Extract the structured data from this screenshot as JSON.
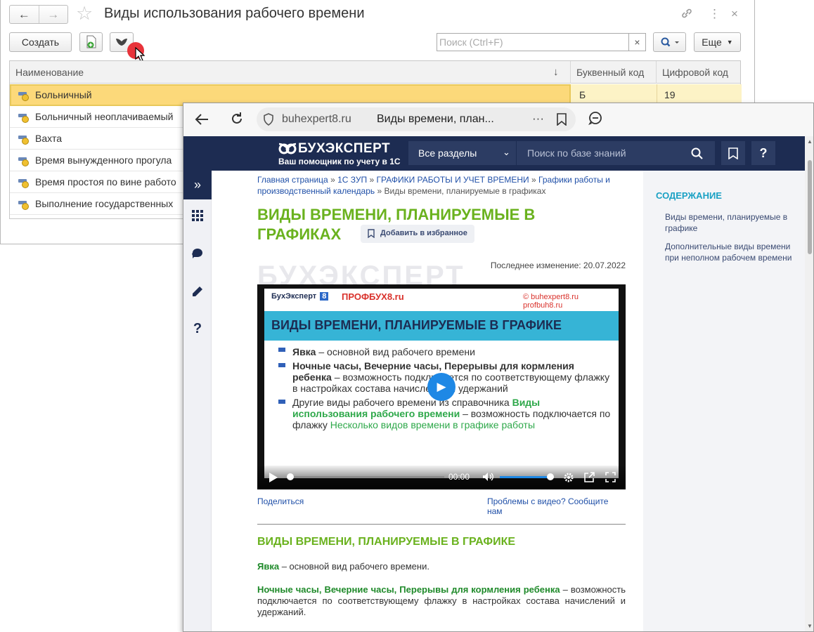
{
  "win1c": {
    "title": "Виды использования рабочего времени",
    "back_icon": "←",
    "forward_icon": "→",
    "link_icon": "🔗",
    "more_icon": "⋮",
    "close_icon": "×",
    "create_label": "Создать",
    "more_label": "Еще",
    "search_placeholder": "Поиск (Ctrl+F)",
    "search_clear": "×",
    "sort_indicator": "↓",
    "columns": [
      "Наименование",
      "Буквенный код",
      "Цифровой код"
    ],
    "rows": [
      {
        "name": "Больничный",
        "letter": "Б",
        "digit": "19"
      },
      {
        "name": "Больничный неоплачиваемый",
        "letter": "",
        "digit": ""
      },
      {
        "name": "Вахта",
        "letter": "",
        "digit": ""
      },
      {
        "name": "Время вынужденного прогула",
        "letter": "",
        "digit": ""
      },
      {
        "name": "Время простоя по вине работо",
        "letter": "",
        "digit": ""
      },
      {
        "name": "Выполнение государственных",
        "letter": "",
        "digit": ""
      }
    ]
  },
  "browser": {
    "url": "buhexpert8.ru",
    "tab_title": "Виды времени, план...",
    "url_more": "···",
    "header": {
      "logo": "БУХЭКСПЕРТ",
      "tagline": "Ваш помощник по учету в 1С",
      "sections": "Все разделы",
      "search_placeholder": "Поиск по базе знаний",
      "help": "?"
    },
    "breadcrumb": {
      "home": "Главная страница",
      "zup": "1С ЗУП",
      "graphs": "ГРАФИКИ РАБОТЫ И УЧЕТ ВРЕМЕНИ",
      "calendar": "Графики работы и производственный календарь",
      "current": "Виды времени, планируемые в графиках",
      "separator": "»"
    },
    "title_line1": "ВИДЫ ВРЕМЕНИ, ПЛАНИРУЕМЫЕ В",
    "title_line2": "ГРАФИКАХ",
    "favorite_label": "Добавить в избранное",
    "last_change": "Последнее изменение: 20.07.2022",
    "watermark": "БУХЭКСПЕРТ",
    "video": {
      "brand1": "БухЭксперт",
      "brand1_badge": "8",
      "brand2": "ПРОФБУХ8.ru",
      "copyright": "© buhexpert8.ru profbuh8.ru",
      "slide_title": "ВИДЫ ВРЕМЕНИ, ПЛАНИРУЕМЫЕ В ГРАФИКЕ",
      "b1_bold": "Явка",
      "b1_rest": " – основной вид рабочего времени",
      "b2_bold": "Ночные часы, Вечерние часы, Перерывы для кормления ребенка",
      "b2_rest": " – возможность подключается по соответствующему флажку в настройках состава начислений и удержаний",
      "b3_pre": "Другие виды рабочего времени из справочника ",
      "b3_green": "Виды использования рабочего времени",
      "b3_mid": " – возможность подключается по флажку ",
      "b3_green2": "Несколько видов времени в графике работы",
      "time": "00:00"
    },
    "share_label": "Поделиться",
    "report_label": "Проблемы с видео? Сообщите нам",
    "section_title": "ВИДЫ ВРЕМЕНИ, ПЛАНИРУЕМЫЕ В ГРАФИКЕ",
    "p1_bold": "Явка",
    "p1_rest": " – основной вид рабочего времени.",
    "p2_bold": "Ночные часы, Вечерние часы, Перерывы для кормления ребенка",
    "p2_rest": " – возможность подключается по соответствующему флажку в настройках состава начислений и удержаний.",
    "toc": {
      "heading": "СОДЕРЖАНИЕ",
      "items": [
        "Виды времени, планируемые в графике",
        "Дополнительные виды времени при неполном рабочем времени"
      ]
    },
    "sidebar_expand": "»"
  },
  "colors": {
    "brand_navy": "#1d2c52",
    "green_title": "#6ab21e",
    "link_blue": "#2050a8",
    "selection_yellow": "#fcd97a",
    "toc_teal": "#1aa1c4"
  }
}
